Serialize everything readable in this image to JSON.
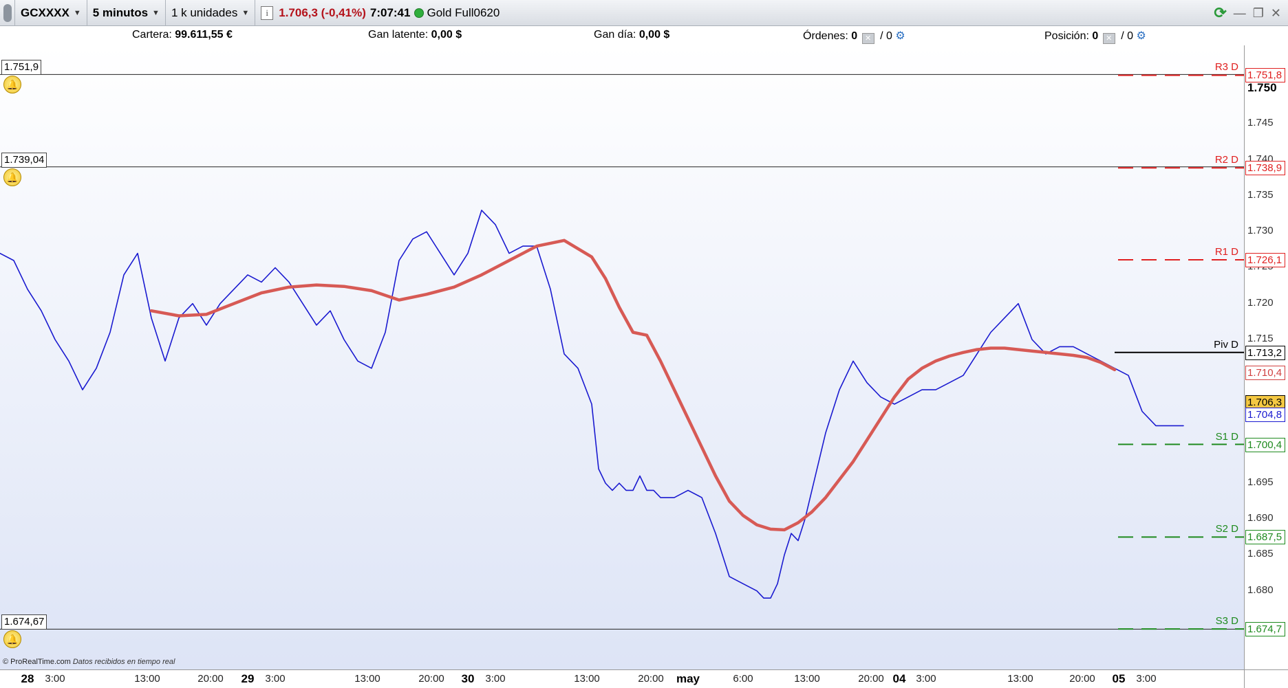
{
  "toolbar": {
    "symbol": "GCXXXX",
    "timeframe": "5 minutos",
    "units": "1 k unidades",
    "info": "i",
    "price_change": "1.706,3 (-0,41%)",
    "clock": "7:07:41",
    "instrument": "Gold Full0620",
    "status_color": "#2fae3c"
  },
  "account": {
    "cartera_label": "Cartera:",
    "cartera_value": "99.611,55 €",
    "gan_latente_label": "Gan latente:",
    "gan_latente_value": "0,00 $",
    "gan_dia_label": "Gan día:",
    "gan_dia_value": "0,00 $",
    "ordenes_label": "Órdenes:",
    "ordenes_value": "0",
    "ordenes_sep": "/ 0",
    "posicion_label": "Posición:",
    "posicion_value": "0",
    "posicion_sep": "/ 0"
  },
  "horizontal_lines": [
    {
      "label": "1.751,9",
      "price": 1751.9
    },
    {
      "label": "1.739,04",
      "price": 1739.04
    },
    {
      "label": "1.674,67",
      "price": 1674.67
    }
  ],
  "credit": {
    "site": "© ProRealTime.com",
    "note": "Datos recibidos en tiempo real"
  },
  "chart_data": {
    "type": "line",
    "ylim": [
      1670.5,
      1755.0
    ],
    "y_ticks": [
      {
        "value": 1750,
        "label": "1.750",
        "major": true
      },
      {
        "value": 1745,
        "label": "1.745"
      },
      {
        "value": 1740,
        "label": "1.740"
      },
      {
        "value": 1735,
        "label": "1.735"
      },
      {
        "value": 1730,
        "label": "1.730"
      },
      {
        "value": 1725,
        "label": "1.725"
      },
      {
        "value": 1720,
        "label": "1.720"
      },
      {
        "value": 1715,
        "label": "1.715"
      },
      {
        "value": 1710,
        "label": "1.710"
      },
      {
        "value": 1705,
        "label": "1.705"
      },
      {
        "value": 1700,
        "label": "1.700"
      },
      {
        "value": 1695,
        "label": "1.695"
      },
      {
        "value": 1690,
        "label": "1.690"
      },
      {
        "value": 1685,
        "label": "1.685"
      },
      {
        "value": 1680,
        "label": "1.680"
      },
      {
        "value": 1675,
        "label": "1.675"
      }
    ],
    "x_range": [
      0,
      1808
    ],
    "x_ticks": [
      {
        "t": 40,
        "label": "28",
        "major": true
      },
      {
        "t": 80,
        "label": "3:00"
      },
      {
        "t": 214,
        "label": "13:00"
      },
      {
        "t": 306,
        "label": "20:00"
      },
      {
        "t": 360,
        "label": "29",
        "major": true
      },
      {
        "t": 400,
        "label": "3:00"
      },
      {
        "t": 534,
        "label": "13:00"
      },
      {
        "t": 627,
        "label": "20:00"
      },
      {
        "t": 680,
        "label": "30",
        "major": true
      },
      {
        "t": 720,
        "label": "3:00"
      },
      {
        "t": 853,
        "label": "13:00"
      },
      {
        "t": 946,
        "label": "20:00"
      },
      {
        "t": 1000,
        "label": "may",
        "major": true
      },
      {
        "t": 1080,
        "label": "6:00"
      },
      {
        "t": 1173,
        "label": "13:00"
      },
      {
        "t": 1266,
        "label": "20:00"
      },
      {
        "t": 1307,
        "label": "04",
        "major": true
      },
      {
        "t": 1346,
        "label": "3:00"
      },
      {
        "t": 1483,
        "label": "13:00"
      },
      {
        "t": 1573,
        "label": "20:00"
      },
      {
        "t": 1626,
        "label": "05",
        "major": true
      },
      {
        "t": 1666,
        "label": "3:00"
      }
    ],
    "pivots": [
      {
        "name": "R3 D",
        "value": 1751.8,
        "label": "1.751,8",
        "color": "#e02020"
      },
      {
        "name": "R2 D",
        "value": 1738.9,
        "label": "1.738,9",
        "color": "#e02020"
      },
      {
        "name": "R1 D",
        "value": 1726.1,
        "label": "1.726,1",
        "color": "#e02020"
      },
      {
        "name": "Piv D",
        "value": 1713.2,
        "label": "1.713,2",
        "color": "#000000"
      },
      {
        "name": "S1 D",
        "value": 1700.4,
        "label": "1.700,4",
        "color": "#1e8a1e"
      },
      {
        "name": "S2 D",
        "value": 1687.5,
        "label": "1.687,5",
        "color": "#1e8a1e"
      },
      {
        "name": "S3 D",
        "value": 1674.7,
        "label": "1.674,7",
        "color": "#1e8a1e"
      }
    ],
    "badges": [
      {
        "label": "1.710,4",
        "value": 1710.4,
        "bg": "#ffffff",
        "color": "#d04040"
      },
      {
        "label": "1.706,3",
        "value": 1706.3,
        "bg": "#f4c842",
        "color": "#000000"
      },
      {
        "label": "1.704,8",
        "value": 1704.6,
        "bg": "#ffffff",
        "color": "#1a1ad0"
      }
    ],
    "series": [
      {
        "name": "price",
        "color": "#1a1ad0",
        "t": [
          0,
          20,
          40,
          60,
          80,
          100,
          120,
          140,
          160,
          180,
          200,
          220,
          240,
          260,
          280,
          300,
          320,
          340,
          360,
          380,
          400,
          420,
          440,
          460,
          480,
          500,
          520,
          540,
          560,
          580,
          600,
          620,
          640,
          660,
          680,
          700,
          720,
          740,
          760,
          780,
          800,
          820,
          840,
          860,
          870,
          880,
          890,
          900,
          910,
          920,
          930,
          940,
          950,
          960,
          980,
          1000,
          1020,
          1040,
          1060,
          1080,
          1100,
          1110,
          1120,
          1130,
          1140,
          1150,
          1160,
          1170,
          1180,
          1200,
          1220,
          1240,
          1260,
          1280,
          1300,
          1320,
          1340,
          1360,
          1380,
          1400,
          1420,
          1440,
          1460,
          1480,
          1500,
          1520,
          1540,
          1560,
          1580,
          1600,
          1620,
          1640,
          1660,
          1680,
          1700,
          1720
        ],
        "values": [
          1727,
          1726,
          1722,
          1719,
          1715,
          1712,
          1708,
          1711,
          1716,
          1724,
          1727,
          1718,
          1712,
          1718,
          1720,
          1717,
          1720,
          1722,
          1724,
          1723,
          1725,
          1723,
          1720,
          1717,
          1719,
          1715,
          1712,
          1711,
          1716,
          1726,
          1729,
          1730,
          1727,
          1724,
          1727,
          1733,
          1731,
          1727,
          1728,
          1728,
          1722,
          1713,
          1711,
          1706,
          1697,
          1695,
          1694,
          1695,
          1694,
          1694,
          1696,
          1694,
          1694,
          1693,
          1693,
          1694,
          1693,
          1688,
          1682,
          1681,
          1680,
          1679,
          1679,
          1681,
          1685,
          1688,
          1687,
          1690,
          1694,
          1702,
          1708,
          1712,
          1709,
          1707,
          1706,
          1707,
          1708,
          1708,
          1709,
          1710,
          1713,
          1716,
          1718,
          1720,
          1715,
          1713,
          1714,
          1714,
          1713,
          1712,
          1711,
          1710,
          1705,
          1703,
          1703,
          1703
        ]
      },
      {
        "name": "moving-average",
        "color": "#d75a55",
        "t": [
          220,
          260,
          300,
          340,
          380,
          420,
          460,
          500,
          540,
          580,
          620,
          660,
          700,
          740,
          780,
          820,
          860,
          880,
          900,
          920,
          940,
          960,
          980,
          1000,
          1020,
          1040,
          1060,
          1080,
          1100,
          1120,
          1140,
          1160,
          1180,
          1200,
          1220,
          1240,
          1260,
          1280,
          1300,
          1320,
          1340,
          1360,
          1380,
          1400,
          1420,
          1440,
          1460,
          1480,
          1500,
          1520,
          1540,
          1560,
          1580,
          1600,
          1620,
          1640,
          1660,
          1680,
          1700,
          1720
        ],
        "values": [
          1719,
          1718.3,
          1718.5,
          1720,
          1721.5,
          1722.3,
          1722.6,
          1722.4,
          1721.8,
          1720.5,
          1721.3,
          1722.3,
          1724,
          1726,
          1728,
          1728.8,
          1726.5,
          1723.5,
          1719.5,
          1716,
          1715.6,
          1712,
          1708,
          1704,
          1700,
          1696,
          1692.5,
          1690.5,
          1689.2,
          1688.6,
          1688.5,
          1689.5,
          1691,
          1693,
          1695.5,
          1698,
          1701,
          1704,
          1707,
          1709.5,
          1711,
          1712,
          1712.7,
          1713.2,
          1713.6,
          1713.8,
          1713.8,
          1713.6,
          1713.4,
          1713.2,
          1713.0,
          1712.8,
          1712.5,
          1711.8,
          1710.8
        ]
      }
    ]
  }
}
